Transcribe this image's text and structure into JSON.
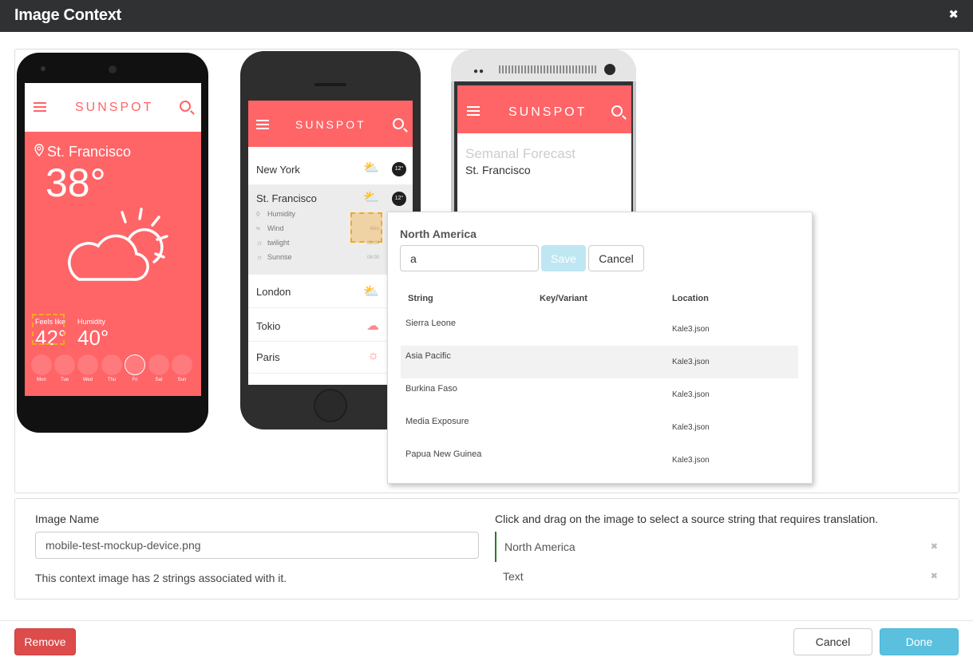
{
  "dialog": {
    "title": "Image Context",
    "close_glyph": "✖"
  },
  "android": {
    "logo": "SUNSPOT",
    "city": "St. Francisco",
    "temperature": "38°",
    "feels_like_label": "Feels like",
    "feels_like_value": "42°",
    "humidity_label": "Humidity",
    "humidity_value": "40°",
    "days": [
      "Mon",
      "Tue",
      "Wed",
      "Thu",
      "Fri",
      "Sat",
      "Sun"
    ]
  },
  "iphone": {
    "logo": "SUNSPOT",
    "cities": [
      {
        "name": "New York",
        "deg": "12°"
      },
      {
        "name": "St. Francisco",
        "deg": "12°"
      },
      {
        "name": "London"
      },
      {
        "name": "Tokio"
      },
      {
        "name": "Paris"
      }
    ],
    "details": [
      {
        "label": "Humidity"
      },
      {
        "label": "Wind",
        "value": "45m"
      },
      {
        "label": "twilight",
        "value": "06:00"
      },
      {
        "label": "Sunrise",
        "value": "06:00"
      }
    ]
  },
  "htc": {
    "logo": "SUNSPOT",
    "subtitle": "Semanal Forecast",
    "city": "St. Francisco"
  },
  "popup": {
    "title": "North America",
    "input_value": "a",
    "save_label": "Save",
    "cancel_label": "Cancel",
    "columns": [
      "String",
      "Key/Variant",
      "Location"
    ],
    "rows": [
      {
        "string": "Sierra Leone",
        "key": "",
        "location": "Kale3.json"
      },
      {
        "string": "Asia Pacific",
        "key": "",
        "location": "Kale3.json"
      },
      {
        "string": "Burkina Faso",
        "key": "",
        "location": "Kale3.json"
      },
      {
        "string": "Media Exposure",
        "key": "",
        "location": "Kale3.json"
      },
      {
        "string": "Papua New Guinea",
        "key": "",
        "location": "Kale3.json"
      }
    ]
  },
  "info": {
    "image_name_label": "Image Name",
    "image_name_value": "mobile-test-mockup-device.png",
    "association_text": "This context image has 2 strings associated with it.",
    "hint": "Click and drag on the image to select a source string that requires translation.",
    "strings": [
      "North America",
      "Text"
    ],
    "remove_glyph": "✖"
  },
  "footer": {
    "remove_label": "Remove",
    "cancel_label": "Cancel",
    "done_label": "Done"
  },
  "colors": {
    "accent": "#ff6467",
    "done": "#5bc0de",
    "remove": "#dd4b4b",
    "selection": "#f5a623"
  }
}
